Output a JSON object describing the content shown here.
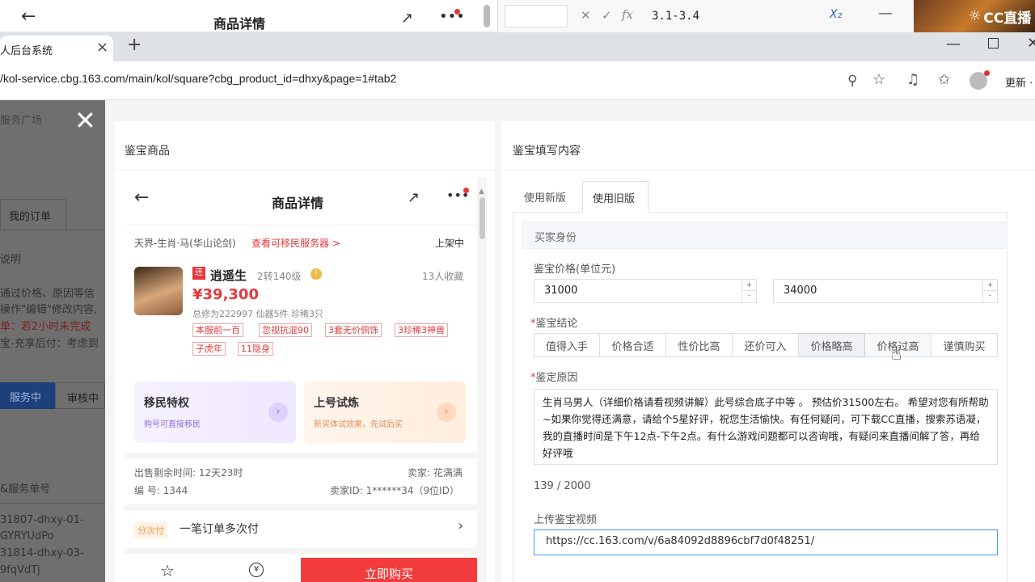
{
  "phone_header": {
    "back_icon": "arrow-left-icon",
    "title": "商品详情"
  },
  "excel": {
    "formula": "3.1-3.4"
  },
  "brand": {
    "logo_text": "CC直播"
  },
  "browser": {
    "tab_title": "人后台系统",
    "tab_close": "×",
    "new_tab": "+",
    "url": "/kol-service.cbg.163.com/main/kol/square?cbg_product_id=dhxy&page=1#tab2",
    "update_label": "更新 ·"
  },
  "left_nav": {
    "service_square": "服务广场",
    "my_orders": "我的订单",
    "explain": "说明",
    "line1": "通过价格、原因等信",
    "line2": "操作\"编辑\"修改内容,",
    "line3": "单：若2小时未完成",
    "line4": "宝-充享后付：考虑到",
    "status_active": "服务中",
    "status_review": "审核中",
    "service_no_label": "&服务单号",
    "order1_a": "31807-dhxy-01-",
    "order1_b": "GYRYUdPo",
    "order2_a": "31814-dhxy-03-",
    "order2_b": "9fqVdTj"
  },
  "left_panel": {
    "title": "鉴宝商品"
  },
  "right_panel": {
    "title": "鉴宝填写内容"
  },
  "product": {
    "header_title": "商品详情",
    "server": "天界-生肖·马(华山论剑)",
    "migrate_link": "查看可移民服务器 >",
    "status": "上架中",
    "name": "逍遥生",
    "badge": "还",
    "level": "2转140级",
    "favorites": "13人收藏",
    "price": "¥39,300",
    "stats": "总修为222997  仙器5件  珍稀3只",
    "tags": [
      "本服前一百",
      "忽视抗混90",
      "3套无价佩饰",
      "3珍稀3神兽",
      "子虎年",
      "11隐身"
    ],
    "privilege1_title": "移民特权",
    "privilege1_sub": "购号可直接移民",
    "privilege2_title": "上号试炼",
    "privilege2_sub": "新买体试效果，先试后买",
    "sale_time": "出售剩余时间: 12天23时",
    "seller": "卖家: 花满满",
    "item_no": "编 号: 1344",
    "seller_id": "卖家ID: 1******34（9位ID）",
    "installment_tag": "分次付",
    "installment_text": "一笔订单多次付",
    "buy_button": "立即购买"
  },
  "form": {
    "tab_new": "使用新版",
    "tab_old": "使用旧版",
    "section_title": "买家身份",
    "price_label": "鉴宝价格(单位元)",
    "price_min": "31000",
    "price_max": "34000",
    "conclusion_label": "鉴宝结论",
    "conclusions": [
      "值得入手",
      "价格合适",
      "性价比高",
      "还价可入",
      "价格略高",
      "价格过高",
      "谨慎购买"
    ],
    "reason_label": "鉴定原因",
    "reason_text": "生肖马男人（详细价格请看视频讲解）此号综合底子中等 。 预估价31500左右。 希望对您有所帮助~如果你觉得还满意，请给个5星好评，祝您生活愉快。有任何疑问，可下载CC直播，搜索苏语凝，我的直播时间是下午12点-下午2点。有什么游戏问题都可以咨询哦，有疑问来直播间解了答，再给好评哦",
    "char_count": "139 / 2000",
    "video_label": "上传鉴宝视频",
    "video_url": "https://cc.163.com/v/6a84092d8896cbf7d0f48251/"
  }
}
